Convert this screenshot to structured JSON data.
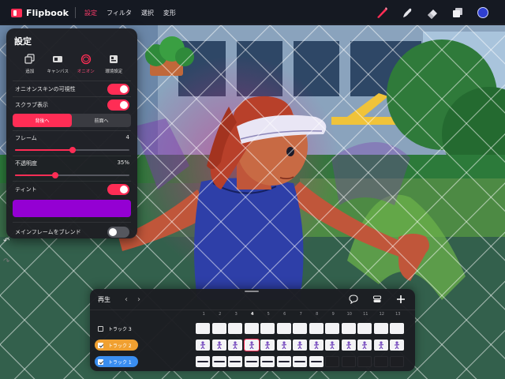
{
  "app": {
    "name": "Flipbook",
    "brand_color": "#ff2d55"
  },
  "menu": {
    "items": [
      {
        "label": "設定",
        "active": true
      },
      {
        "label": "フィルタ",
        "active": false
      },
      {
        "label": "選択",
        "active": false
      },
      {
        "label": "変形",
        "active": false
      }
    ]
  },
  "toolbar": {
    "icons": [
      "brush-icon",
      "smudge-icon",
      "eraser-icon",
      "layers-icon",
      "color-picker"
    ],
    "current_color": "#2f3fd0"
  },
  "settings_panel": {
    "title": "設定",
    "tabs": [
      {
        "label": "追加",
        "icon": "add-icon",
        "active": false
      },
      {
        "label": "キャンバス",
        "icon": "canvas-icon",
        "active": false
      },
      {
        "label": "オニオン",
        "icon": "onion-icon",
        "active": true
      },
      {
        "label": "環境設定",
        "icon": "preferences-icon",
        "active": false
      }
    ],
    "onion_visibility": {
      "label": "オニオンスキンの可視性",
      "on": true
    },
    "scrub_display": {
      "label": "スクラブ表示",
      "on": true
    },
    "direction": {
      "options": [
        "背後へ",
        "前面へ"
      ],
      "selected": "背後へ"
    },
    "frames": {
      "label": "フレーム",
      "value": "4",
      "level": 0.5
    },
    "opacity": {
      "label": "不透明度",
      "value": "35%",
      "level": 0.35
    },
    "tint": {
      "label": "ティント",
      "on": true,
      "color": "#9400d3"
    },
    "blend_main": {
      "label": "メインフレームをブレンド",
      "on": false
    }
  },
  "timeline": {
    "title": "再生",
    "prev_icon": "chevron-left-icon",
    "next_icon": "chevron-right-icon",
    "actions": [
      "comment-icon",
      "layers-stack-icon",
      "add-icon"
    ],
    "frame_numbers": [
      "1",
      "2",
      "3",
      "4",
      "5",
      "6",
      "7",
      "8",
      "9",
      "10",
      "11",
      "12",
      "13"
    ],
    "current_frame": "4",
    "tracks": [
      {
        "label": "トラック 3",
        "checked": false,
        "color": "transparent",
        "kind": "blank"
      },
      {
        "label": "トラック 2",
        "checked": true,
        "color": "#f0a030",
        "kind": "figures"
      },
      {
        "label": "トラック 1",
        "checked": true,
        "color": "#3a8ef0",
        "kind": "strokes"
      }
    ]
  }
}
